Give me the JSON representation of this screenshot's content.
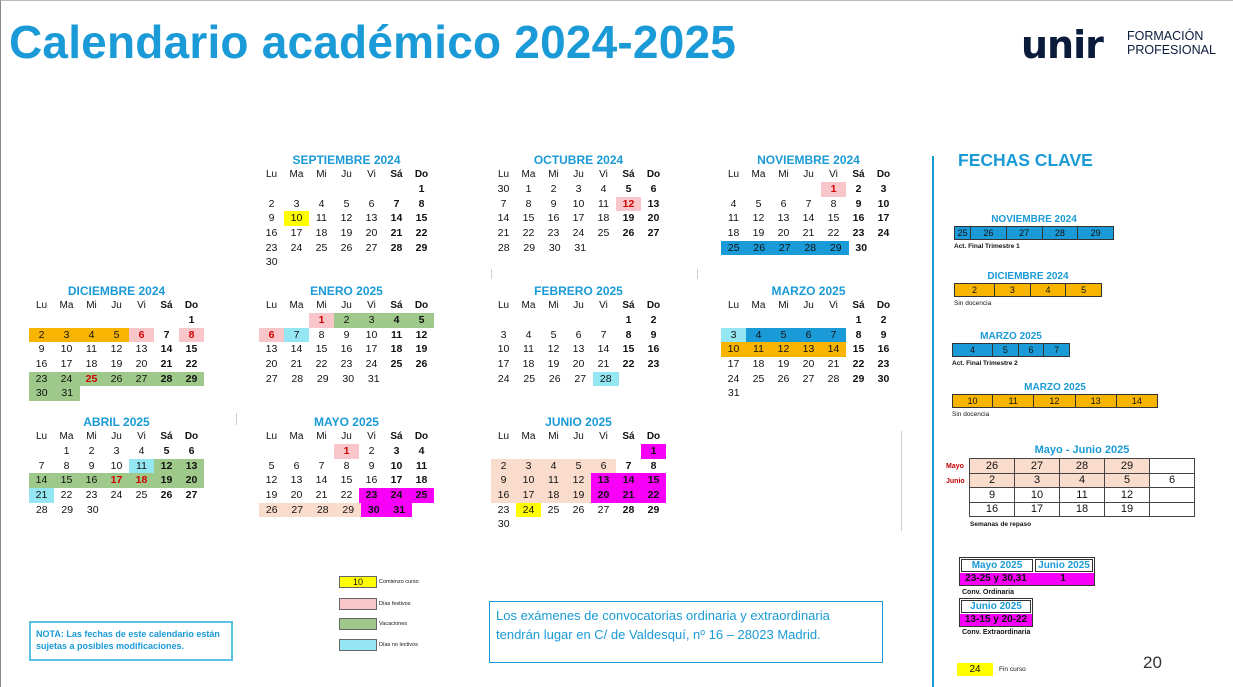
{
  "title": "Calendario académico 2024-2025",
  "logo": {
    "word": "unir",
    "line1": "FORMACIÓN",
    "line2": "PROFESIONAL"
  },
  "weekdays": [
    "Lu",
    "Ma",
    "Mi",
    "Ju",
    "Vi",
    "Sá",
    "Do"
  ],
  "colors": {
    "accent": "#1a9ad6",
    "start": "#ffff00",
    "holiday": "#f8c6c8",
    "vacation": "#9fc98a",
    "no_lective": "#93e6f2",
    "exam": "#f800f8",
    "review": "#f9dccc",
    "blue": "#1a9ad6",
    "orange": "#f7b400"
  },
  "months": [
    {
      "id": "sep",
      "title": "SEPTIEMBRE 2024",
      "offset": 6,
      "days": 30,
      "marks": {
        "10": "start"
      }
    },
    {
      "id": "oct",
      "title": "OCTUBRE 2024",
      "offset": 1,
      "days": 31,
      "prev": [
        30
      ],
      "marks": {
        "12": "holiday"
      }
    },
    {
      "id": "nov",
      "title": "NOVIEMBRE 2024",
      "offset": 4,
      "days": 30,
      "marks": {
        "1": "holiday",
        "25": "blue",
        "26": "blue",
        "27": "blue",
        "28": "blue",
        "29": "blue"
      }
    },
    {
      "id": "dic",
      "title": "DICIEMBRE 2024",
      "offset": 6,
      "days": 31,
      "marks": {
        "2": "orange",
        "3": "orange",
        "4": "orange",
        "5": "orange",
        "6": "holiday",
        "8": "holiday",
        "23": "vac",
        "24": "vac",
        "25": "vac-red",
        "26": "vac",
        "27": "vac",
        "28": "vac",
        "29": "vac",
        "30": "vac",
        "31": "vac"
      }
    },
    {
      "id": "ene",
      "title": "ENERO 2025",
      "offset": 2,
      "days": 31,
      "marks": {
        "1": "holiday-vac",
        "2": "vac",
        "3": "vac",
        "4": "vac",
        "5": "vac",
        "6": "holiday",
        "7": "nolect"
      }
    },
    {
      "id": "feb",
      "title": "FEBRERO 2025",
      "offset": 5,
      "days": 28,
      "marks": {
        "28": "nolect"
      }
    },
    {
      "id": "mar",
      "title": "MARZO 2025",
      "offset": 5,
      "days": 31,
      "marks": {
        "3": "nolect",
        "4": "blue",
        "5": "blue",
        "6": "blue",
        "7": "blue",
        "10": "orange",
        "11": "orange",
        "12": "orange",
        "13": "orange",
        "14": "orange"
      }
    },
    {
      "id": "abr",
      "title": "ABRIL 2025",
      "offset": 1,
      "days": 30,
      "marks": {
        "11": "nolect",
        "12": "vac",
        "13": "vac",
        "14": "vac",
        "15": "vac",
        "16": "vac",
        "17": "vac-red",
        "18": "vac-red",
        "19": "vac",
        "20": "vac",
        "21": "nolect"
      }
    },
    {
      "id": "may",
      "title": "MAYO 2025",
      "offset": 3,
      "days": 31,
      "marks": {
        "1": "holiday",
        "23": "exam",
        "24": "exam",
        "25": "exam",
        "26": "review",
        "27": "review",
        "28": "review",
        "29": "review",
        "30": "exam",
        "31": "exam"
      }
    },
    {
      "id": "jun",
      "title": "JUNIO 2025",
      "offset": 6,
      "days": 30,
      "marks": {
        "1": "exam",
        "2": "review",
        "3": "review",
        "4": "review",
        "5": "review",
        "6": "review",
        "9": "review",
        "10": "review",
        "11": "review",
        "12": "review",
        "13": "exam",
        "14": "exam",
        "15": "exam",
        "16": "review",
        "17": "review",
        "18": "review",
        "19": "review",
        "20": "exam",
        "21": "exam",
        "22": "exam",
        "24": "start"
      }
    }
  ],
  "fechas_clave": {
    "title": "FECHAS CLAVE",
    "blocks": [
      {
        "title": "NOVIEMBRE 2024",
        "days": [
          "25",
          "26",
          "27",
          "28",
          "29"
        ],
        "color": "blue",
        "caption": "Act. Final Trimestre 1",
        "bold": true
      },
      {
        "title": "DICIEMBRE 2024",
        "days": [
          "2",
          "3",
          "4",
          "5"
        ],
        "color": "orange",
        "caption": "Sin docencia",
        "bold": false
      },
      {
        "title": "MARZO 2025",
        "days": [
          "4",
          "5",
          "6",
          "7"
        ],
        "color": "blue",
        "caption": "Act. Final Trimestre 2",
        "bold": true
      },
      {
        "title": "MARZO 2025",
        "days": [
          "10",
          "11",
          "12",
          "13",
          "14"
        ],
        "color": "orange",
        "caption": "Sin docencia",
        "bold": false
      }
    ],
    "review": {
      "title": "Mayo - Junio 2025",
      "label_may": "Mayo",
      "label_jun": "Junio",
      "rows": [
        [
          "26",
          "27",
          "28",
          "29",
          ""
        ],
        [
          "2",
          "3",
          "4",
          "5",
          "6"
        ],
        [
          "9",
          "10",
          "11",
          "12",
          ""
        ],
        [
          "16",
          "17",
          "18",
          "19",
          ""
        ]
      ],
      "caption": "Semanas de repaso"
    },
    "ordinaria": {
      "h1": "Mayo 2025",
      "h2": "Junio 2025",
      "v1": "23-25 y 30,31",
      "v2": "1",
      "caption": "Conv. Ordinaria"
    },
    "extraordinaria": {
      "h1": "Junio 2025",
      "v1": "13-15 y 20-22",
      "caption": "Conv. Extraordinaria"
    }
  },
  "legend": [
    {
      "value": "10",
      "text": "Comienzo curso",
      "color": "start"
    },
    {
      "value": "",
      "text": "Días festivos",
      "color": "holiday"
    },
    {
      "value": "",
      "text": "Vacaciones",
      "color": "vac"
    },
    {
      "value": "",
      "text": "Días no lectivos",
      "color": "nolect"
    }
  ],
  "note": "NOTA: Las fechas de este calendario están sujetas a posibles modificaciones.",
  "exam_note": "Los exámenes de convocatorias ordinaria y extraordinaria tendrán lugar en C/ de Valdesquí, nº 16 – 28023 Madrid.",
  "fin": {
    "value": "24",
    "text": "Fin curso"
  },
  "page_number": "20"
}
